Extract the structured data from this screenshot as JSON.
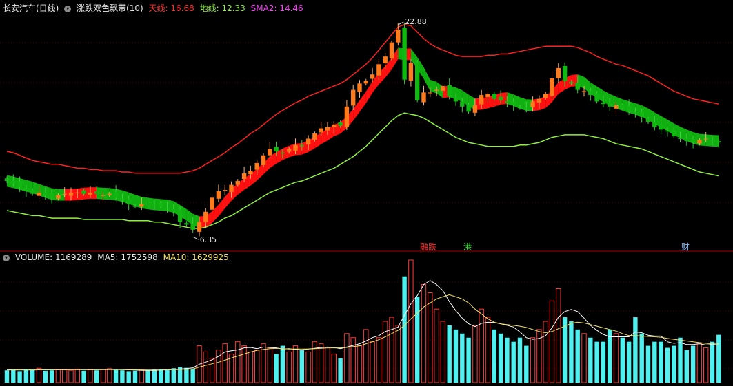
{
  "header": {
    "title": "长安汽车(日线)",
    "indicator": "涨跌双色飘带(10)",
    "sky_label": "天线:",
    "sky_value": "16.68",
    "ground_label": "地线:",
    "ground_value": "12.33",
    "sma_label": "SMA2:",
    "sma_value": "14.46"
  },
  "volume_header": {
    "label": "VOLUME:",
    "value": "1169289",
    "ma5_label": "MA5:",
    "ma5_value": "1752598",
    "ma10_label": "MA10:",
    "ma10_value": "1629925"
  },
  "event_markers": {
    "m1": "融",
    "m2": "跌",
    "m3": "港",
    "m4": "财"
  },
  "colors": {
    "up": "#ff3a3a",
    "down": "#00c000",
    "volume_up": "#ff3a3a",
    "volume_down": "#4ef0f0",
    "sky_line": "#ff2020",
    "ground_line": "#90f040",
    "ma5": "#ffffff",
    "ma10": "#f0e060",
    "grid": "#5a0000"
  },
  "chart_data": {
    "type": "candlestick",
    "y_axis_hidden": true,
    "price_range": [
      5.5,
      24.0
    ],
    "high_label": "22.88",
    "low_label": "6.35",
    "close": [
      10.7,
      10.5,
      10.2,
      9.9,
      9.7,
      9.8,
      9.6,
      9.4,
      9.6,
      9.7,
      9.8,
      9.8,
      9.7,
      9.8,
      9.7,
      9.6,
      9.7,
      9.4,
      9.2,
      8.9,
      8.7,
      8.9,
      9.0,
      8.9,
      8.7,
      8.5,
      8.3,
      7.5,
      7.3,
      6.9,
      7.5,
      8.3,
      9.4,
      9.9,
      10.0,
      10.4,
      10.7,
      11.3,
      11.5,
      12.1,
      12.7,
      13.2,
      13.0,
      12.9,
      13.2,
      13.5,
      13.4,
      14.0,
      14.4,
      14.8,
      14.9,
      15.1,
      15.0,
      16.5,
      17.8,
      18.3,
      18.5,
      19.0,
      19.8,
      20.4,
      21.5,
      22.5,
      18.6,
      19.9,
      17.0,
      17.6,
      17.6,
      17.8,
      18.1,
      17.3,
      16.9,
      16.5,
      16.1,
      16.6,
      17.4,
      17.5,
      17.1,
      17.0,
      16.8,
      16.6,
      16.4,
      16.3,
      16.9,
      17.1,
      17.5,
      18.7,
      19.5,
      18.5,
      18.3,
      17.8,
      17.7,
      17.4,
      16.9,
      16.7,
      16.5,
      16.6,
      16.4,
      16.1,
      16.0,
      15.7,
      15.3,
      14.9,
      14.7,
      14.6,
      14.2,
      14.0,
      13.8,
      13.7,
      13.9,
      14.0,
      13.8,
      13.7
    ],
    "sky_line": [
      13.0,
      12.9,
      12.7,
      12.5,
      12.3,
      12.2,
      12.1,
      12.0,
      12.0,
      11.9,
      11.8,
      11.7,
      11.7,
      11.6,
      11.6,
      11.5,
      11.5,
      11.5,
      11.4,
      11.4,
      11.3,
      11.3,
      11.3,
      11.3,
      11.3,
      11.3,
      11.3,
      11.3,
      11.4,
      11.5,
      11.7,
      12.0,
      12.3,
      12.6,
      12.9,
      13.3,
      13.6,
      14.0,
      14.4,
      14.7,
      15.1,
      15.5,
      15.9,
      16.2,
      16.5,
      16.8,
      17.0,
      17.3,
      17.5,
      17.7,
      17.9,
      18.1,
      18.3,
      18.6,
      19.0,
      19.4,
      19.8,
      20.3,
      20.9,
      21.5,
      22.1,
      22.7,
      22.9,
      22.8,
      22.3,
      21.8,
      21.4,
      21.1,
      20.9,
      20.7,
      20.5,
      20.4,
      20.4,
      20.4,
      20.4,
      20.5,
      20.5,
      20.6,
      20.6,
      20.7,
      20.8,
      20.9,
      21.0,
      21.1,
      21.2,
      21.2,
      21.2,
      21.2,
      21.2,
      21.1,
      20.9,
      20.7,
      20.4,
      20.2,
      20.0,
      19.8,
      19.7,
      19.5,
      19.3,
      19.1,
      18.9,
      18.6,
      18.3,
      18.0,
      17.7,
      17.5,
      17.3,
      17.1,
      17.0,
      16.9,
      16.8,
      16.7
    ],
    "ground_line": [
      8.4,
      8.3,
      8.2,
      8.1,
      8.0,
      8.0,
      7.9,
      7.8,
      7.8,
      7.8,
      7.8,
      7.8,
      7.7,
      7.7,
      7.7,
      7.7,
      7.7,
      7.7,
      7.7,
      7.6,
      7.6,
      7.6,
      7.6,
      7.5,
      7.5,
      7.4,
      7.3,
      7.2,
      7.1,
      7.0,
      7.0,
      7.1,
      7.3,
      7.5,
      7.8,
      8.0,
      8.3,
      8.6,
      8.9,
      9.2,
      9.5,
      9.8,
      10.0,
      10.2,
      10.4,
      10.6,
      10.7,
      10.9,
      11.1,
      11.3,
      11.5,
      11.7,
      12.0,
      12.3,
      12.6,
      13.0,
      13.4,
      13.9,
      14.4,
      14.9,
      15.4,
      15.8,
      16.0,
      15.9,
      15.8,
      15.6,
      15.3,
      15.0,
      14.7,
      14.4,
      14.1,
      13.9,
      13.7,
      13.6,
      13.5,
      13.4,
      13.4,
      13.4,
      13.4,
      13.4,
      13.5,
      13.5,
      13.6,
      13.7,
      13.9,
      14.1,
      14.2,
      14.3,
      14.3,
      14.3,
      14.3,
      14.2,
      14.1,
      14.0,
      13.8,
      13.6,
      13.5,
      13.4,
      13.3,
      13.2,
      13.0,
      12.8,
      12.6,
      12.4,
      12.2,
      12.0,
      11.8,
      11.6,
      11.4,
      11.3,
      11.2,
      11.1
    ],
    "volume_scale_max": 3000000,
    "volume": [
      300000,
      320000,
      280000,
      330000,
      310000,
      350000,
      290000,
      300000,
      320000,
      310000,
      300000,
      330000,
      290000,
      310000,
      300000,
      320000,
      340000,
      310000,
      300000,
      280000,
      290000,
      310000,
      300000,
      320000,
      330000,
      310000,
      350000,
      380000,
      360000,
      340000,
      900000,
      750000,
      600000,
      800000,
      950000,
      700000,
      1000000,
      900000,
      750000,
      800000,
      950000,
      850000,
      700000,
      900000,
      750000,
      900000,
      800000,
      750000,
      1000000,
      950000,
      850000,
      700000,
      600000,
      1200000,
      1100000,
      900000,
      1300000,
      1000000,
      1100000,
      1500000,
      1600000,
      1400000,
      2600000,
      3000000,
      2100000,
      2400000,
      2200000,
      1800000,
      1500000,
      1400000,
      1300000,
      1200000,
      1100000,
      1400000,
      1800000,
      1600000,
      1300000,
      1200000,
      1100000,
      1000000,
      1100000,
      900000,
      1100000,
      1300000,
      1500000,
      2000000,
      2300000,
      1600000,
      1500000,
      1300000,
      1200000,
      1100000,
      1000000,
      1000000,
      1300000,
      1200000,
      1100000,
      1000000,
      1600000,
      1200000,
      900000,
      1000000,
      1000000,
      850000,
      900000,
      1100000,
      800000,
      900000,
      950000,
      850000,
      1000000,
      1169289
    ],
    "ma5": [
      310000,
      310000,
      310000,
      310000,
      310000,
      312000,
      314000,
      316000,
      316000,
      316000,
      318000,
      318000,
      316000,
      316000,
      316000,
      318000,
      320000,
      320000,
      318000,
      312000,
      306000,
      300000,
      298000,
      300000,
      306000,
      312000,
      318000,
      330000,
      340000,
      360000,
      450000,
      500000,
      560000,
      640000,
      750000,
      780000,
      800000,
      850000,
      860000,
      830000,
      870000,
      860000,
      850000,
      820000,
      830000,
      810000,
      800000,
      820000,
      840000,
      860000,
      870000,
      860000,
      830000,
      870000,
      910000,
      950000,
      1020000,
      1100000,
      1150000,
      1250000,
      1300000,
      1360000,
      1650000,
      1930000,
      2130000,
      2400000,
      2500000,
      2400000,
      2250000,
      1980000,
      1760000,
      1580000,
      1440000,
      1370000,
      1450000,
      1480000,
      1470000,
      1440000,
      1400000,
      1360000,
      1240000,
      1100000,
      1060000,
      1080000,
      1150000,
      1340000,
      1600000,
      1740000,
      1790000,
      1740000,
      1580000,
      1400000,
      1280000,
      1180000,
      1120000,
      1120000,
      1120000,
      1120000,
      1240000,
      1220000,
      1160000,
      1140000,
      1140000,
      1000000,
      960000,
      980000,
      930000,
      930000,
      950000,
      920000,
      930000,
      950000
    ],
    "ma10": [
      310000,
      310000,
      310000,
      310000,
      310000,
      311000,
      312000,
      313000,
      314000,
      314000,
      315000,
      316000,
      315000,
      315000,
      315000,
      316000,
      317000,
      317000,
      317000,
      315000,
      312000,
      310000,
      308000,
      308000,
      310000,
      312000,
      315000,
      320000,
      325000,
      330000,
      380000,
      420000,
      460000,
      500000,
      550000,
      600000,
      650000,
      700000,
      750000,
      790000,
      810000,
      830000,
      840000,
      830000,
      820000,
      820000,
      820000,
      820000,
      830000,
      840000,
      850000,
      850000,
      850000,
      860000,
      880000,
      900000,
      950000,
      1000000,
      1050000,
      1120000,
      1200000,
      1280000,
      1400000,
      1560000,
      1700000,
      1850000,
      1950000,
      2050000,
      2100000,
      2150000,
      2100000,
      2050000,
      1950000,
      1800000,
      1680000,
      1560000,
      1480000,
      1440000,
      1420000,
      1400000,
      1380000,
      1350000,
      1300000,
      1250000,
      1220000,
      1250000,
      1320000,
      1380000,
      1450000,
      1480000,
      1460000,
      1420000,
      1380000,
      1340000,
      1300000,
      1260000,
      1200000,
      1150000,
      1150000,
      1140000,
      1130000,
      1120000,
      1110000,
      1080000,
      1060000,
      1040000,
      1020000,
      1000000,
      980000,
      960000,
      950000,
      940000
    ]
  }
}
